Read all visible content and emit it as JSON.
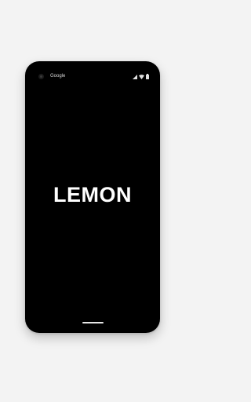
{
  "status_bar": {
    "carrier": "Google",
    "icons": [
      "signal-icon",
      "wifi-icon",
      "battery-icon"
    ]
  },
  "splash": {
    "brand": "LEMON",
    "background_color": "#000000",
    "text_color": "#ffffff"
  }
}
